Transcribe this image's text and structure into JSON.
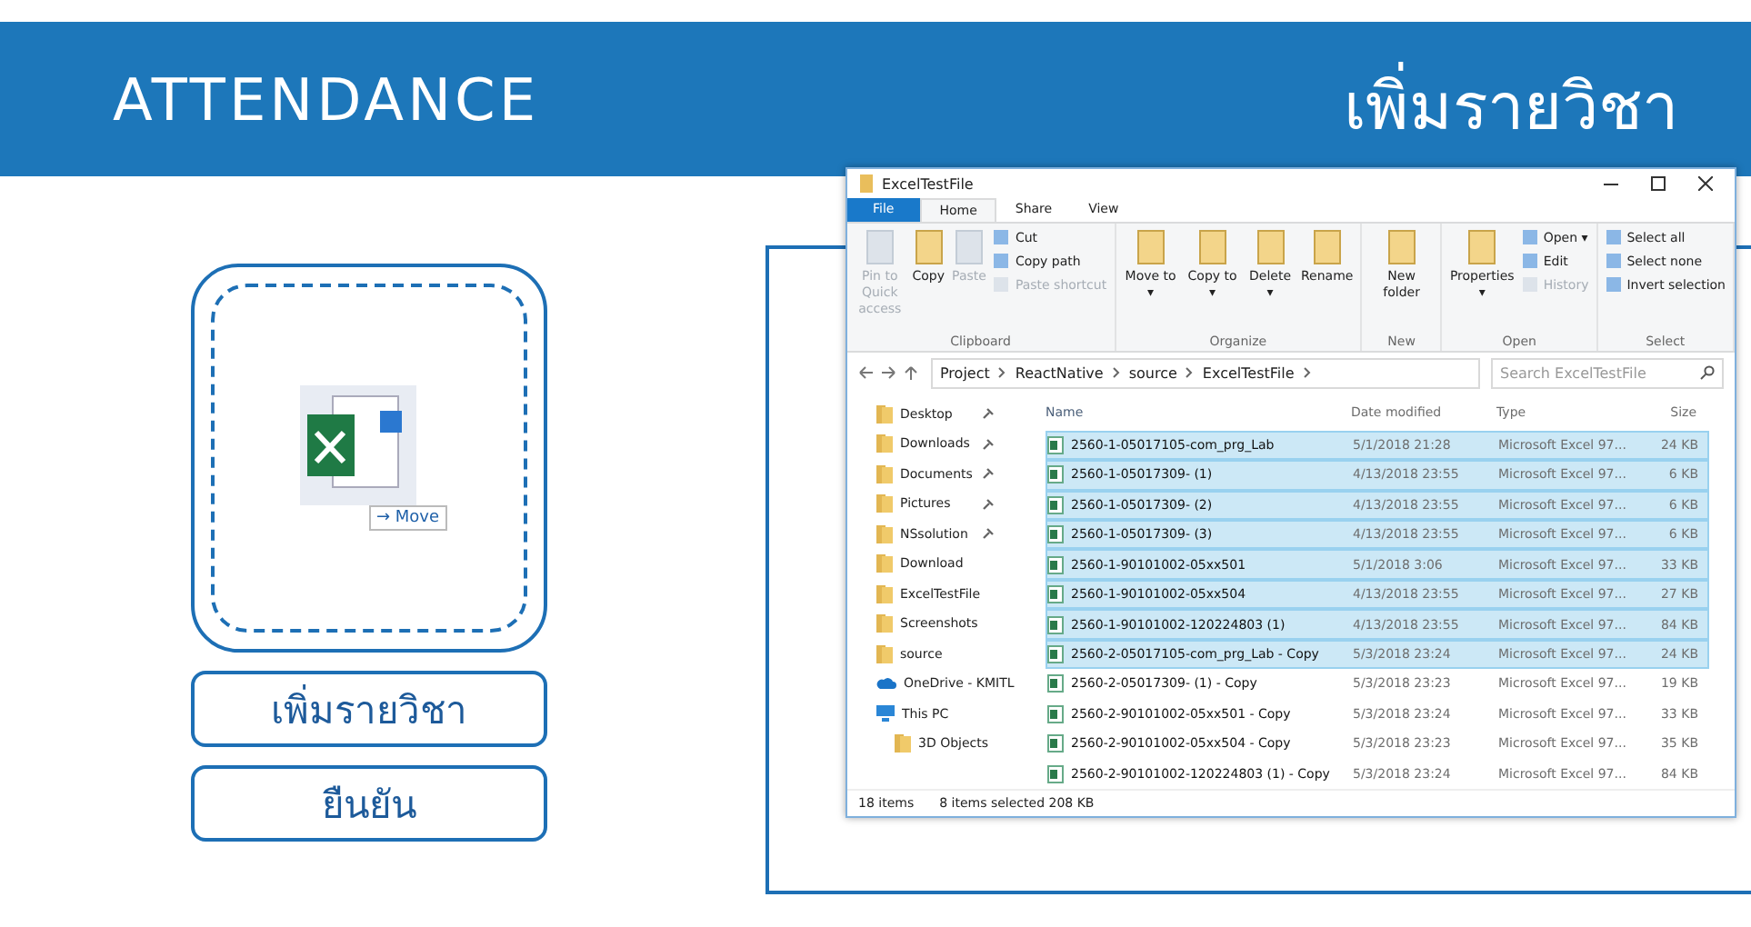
{
  "header": {
    "title": "ATTENDANCE",
    "subtitle": "เพิ่มรายวิชา"
  },
  "drop_zone": {
    "drag_label": "→ Move"
  },
  "buttons": [
    "เพิ่มรายวิชา",
    "ยืนยัน"
  ],
  "explorer": {
    "title": "ExcelTestFile",
    "tabs": [
      {
        "label": "File",
        "selected": false,
        "kind": "file"
      },
      {
        "label": "Home",
        "selected": true,
        "kind": "tab"
      },
      {
        "label": "Share",
        "selected": false,
        "kind": "tab"
      },
      {
        "label": "View",
        "selected": false,
        "kind": "tab"
      }
    ],
    "ribbon": [
      {
        "label": "Clipboard",
        "items": [
          {
            "label": "Pin to Quick access",
            "kind": "large",
            "disabled": true
          },
          {
            "label": "Copy",
            "kind": "large",
            "disabled": false
          },
          {
            "label": "Paste",
            "kind": "large",
            "disabled": true
          },
          {
            "label": "Cut",
            "kind": "small",
            "disabled": false
          },
          {
            "label": "Copy path",
            "kind": "small",
            "disabled": false
          },
          {
            "label": "Paste shortcut",
            "kind": "small",
            "disabled": true
          }
        ]
      },
      {
        "label": "Organize",
        "items": [
          {
            "label": "Move to ▾",
            "kind": "large",
            "disabled": false
          },
          {
            "label": "Copy to ▾",
            "kind": "large",
            "disabled": false
          },
          {
            "label": "Delete ▾",
            "kind": "large",
            "disabled": false
          },
          {
            "label": "Rename",
            "kind": "large",
            "disabled": false
          }
        ]
      },
      {
        "label": "New",
        "items": [
          {
            "label": "New folder",
            "kind": "large",
            "disabled": false
          }
        ]
      },
      {
        "label": "Open",
        "items": [
          {
            "label": "Properties ▾",
            "kind": "large",
            "disabled": false
          },
          {
            "label": "Open ▾",
            "kind": "small",
            "disabled": false
          },
          {
            "label": "Edit",
            "kind": "small",
            "disabled": false
          },
          {
            "label": "History",
            "kind": "small",
            "disabled": true
          }
        ]
      },
      {
        "label": "Select",
        "items": [
          {
            "label": "Select all",
            "kind": "small",
            "disabled": false
          },
          {
            "label": "Select none",
            "kind": "small",
            "disabled": false
          },
          {
            "label": "Invert selection",
            "kind": "small",
            "disabled": false
          }
        ]
      }
    ],
    "path": [
      "Project",
      "ReactNative",
      "source",
      "ExcelTestFile"
    ],
    "search": {
      "placeholder": "Search ExcelTestFile"
    },
    "nav": [
      {
        "label": "Desktop",
        "pinned": true
      },
      {
        "label": "Downloads",
        "pinned": true
      },
      {
        "label": "Documents",
        "pinned": true
      },
      {
        "label": "Pictures",
        "pinned": true
      },
      {
        "label": "NSsolution",
        "pinned": true
      },
      {
        "label": "Download",
        "pinned": false
      },
      {
        "label": "ExcelTestFile",
        "pinned": false
      },
      {
        "label": "Screenshots",
        "pinned": false
      },
      {
        "label": "source",
        "pinned": false
      },
      {
        "label": "OneDrive - KMITL",
        "pinned": false,
        "kind": "cloud"
      },
      {
        "label": "This PC",
        "pinned": false,
        "kind": "pc",
        "children": [
          {
            "label": "3D Objects",
            "pinned": false
          }
        ]
      }
    ],
    "columns": [
      "Name",
      "Date modified",
      "Type",
      "Size"
    ],
    "rows": [
      {
        "name": "2560-1-05017105-com_prg_Lab",
        "date": "5/1/2018 21:28",
        "type": "Microsoft Excel 97...",
        "size": "24 KB",
        "selected": true
      },
      {
        "name": "2560-1-05017309- (1)",
        "date": "4/13/2018 23:55",
        "type": "Microsoft Excel 97...",
        "size": "6 KB",
        "selected": true
      },
      {
        "name": "2560-1-05017309- (2)",
        "date": "4/13/2018 23:55",
        "type": "Microsoft Excel 97...",
        "size": "6 KB",
        "selected": true
      },
      {
        "name": "2560-1-05017309- (3)",
        "date": "4/13/2018 23:55",
        "type": "Microsoft Excel 97...",
        "size": "6 KB",
        "selected": true
      },
      {
        "name": "2560-1-90101002-05xx501",
        "date": "5/1/2018 3:06",
        "type": "Microsoft Excel 97...",
        "size": "33 KB",
        "selected": true
      },
      {
        "name": "2560-1-90101002-05xx504",
        "date": "4/13/2018 23:55",
        "type": "Microsoft Excel 97...",
        "size": "27 KB",
        "selected": true
      },
      {
        "name": "2560-1-90101002-120224803 (1)",
        "date": "4/13/2018 23:55",
        "type": "Microsoft Excel 97...",
        "size": "84 KB",
        "selected": true
      },
      {
        "name": "2560-2-05017105-com_prg_Lab - Copy",
        "date": "5/3/2018 23:24",
        "type": "Microsoft Excel 97...",
        "size": "24 KB",
        "selected": true
      },
      {
        "name": "2560-2-05017309- (1) - Copy",
        "date": "5/3/2018 23:23",
        "type": "Microsoft Excel 97...",
        "size": "19 KB",
        "selected": false
      },
      {
        "name": "2560-2-90101002-05xx501 - Copy",
        "date": "5/3/2018 23:24",
        "type": "Microsoft Excel 97...",
        "size": "33 KB",
        "selected": false
      },
      {
        "name": "2560-2-90101002-05xx504 - Copy",
        "date": "5/3/2018 23:23",
        "type": "Microsoft Excel 97...",
        "size": "35 KB",
        "selected": false
      },
      {
        "name": "2560-2-90101002-120224803 (1) - Copy",
        "date": "5/3/2018 23:24",
        "type": "Microsoft Excel 97...",
        "size": "84 KB",
        "selected": false
      }
    ],
    "status": {
      "count": "18 items",
      "selection": "8 items selected  208 KB"
    }
  }
}
